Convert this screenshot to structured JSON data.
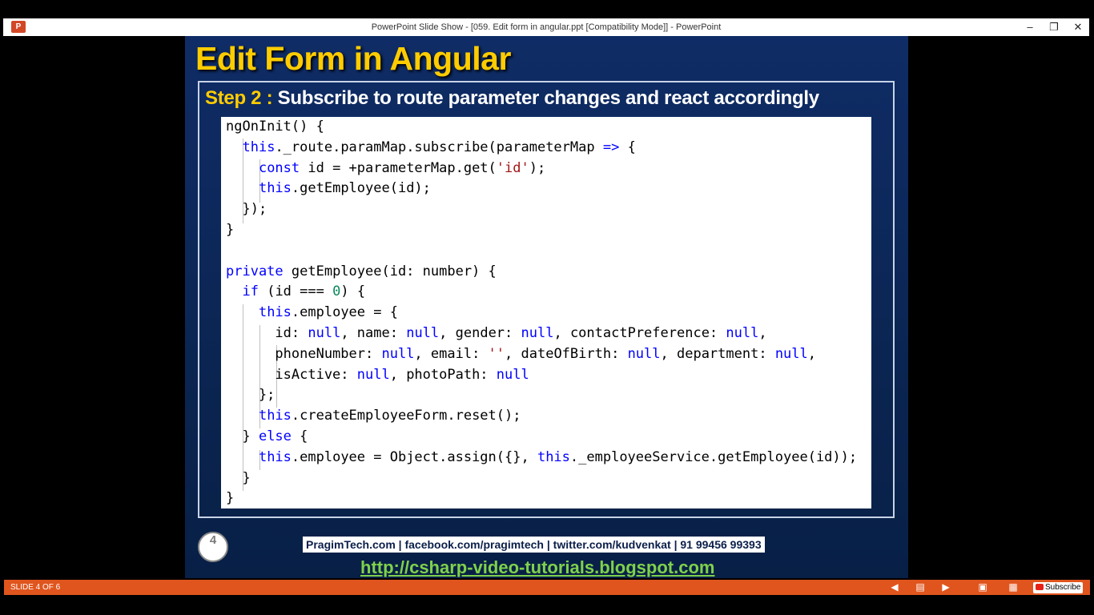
{
  "window": {
    "title": "PowerPoint Slide Show - [059. Edit form in angular.ppt [Compatibility Mode]] - PowerPoint",
    "app_icon": "P",
    "minimize": "–",
    "restore": "❐",
    "close": "✕"
  },
  "slide": {
    "title": "Edit Form in Angular",
    "step_label": "Step 2 :",
    "step_text": "Subscribe to route parameter changes and react accordingly",
    "page_number": "4",
    "contact": "PragimTech.com | facebook.com/pragimtech  | twitter.com/kudvenkat  | 91 99456 99393",
    "link": "http://csharp-video-tutorials.blogspot.com"
  },
  "code_lines": [
    "ngOnInit() {",
    "  this._route.paramMap.subscribe(parameterMap => {",
    "    const id = +parameterMap.get('id');",
    "    this.getEmployee(id);",
    "  });",
    "}",
    "",
    "private getEmployee(id: number) {",
    "  if (id === 0) {",
    "    this.employee = {",
    "      id: null, name: null, gender: null, contactPreference: null,",
    "      phoneNumber: null, email: '', dateOfBirth: null, department: null,",
    "      isActive: null, photoPath: null",
    "    };",
    "    this.createEmployeeForm.reset();",
    "  } else {",
    "    this.employee = Object.assign({}, this._employeeService.getEmployee(id));",
    "  }",
    "}"
  ],
  "statusbar": {
    "slide_counter": "SLIDE 4 OF 6",
    "subscribe_label": "Subscribe",
    "icons": [
      "previous-icon",
      "slide-sorter-icon",
      "next-icon",
      "normal-view-icon",
      "grid-view-icon"
    ]
  },
  "colors": {
    "title": "#ffcc00",
    "keyword": "#0000ff",
    "string": "#a31515",
    "number": "#09885a",
    "statusbar": "#e0551e",
    "link": "#7fd14b"
  }
}
